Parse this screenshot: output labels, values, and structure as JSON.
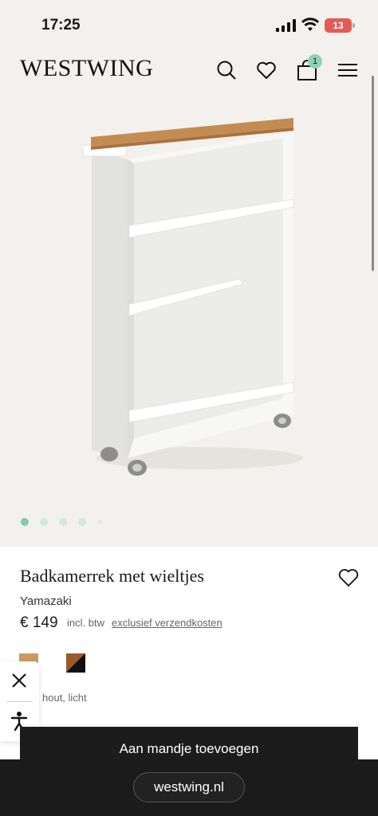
{
  "status": {
    "time": "17:25",
    "battery": "13"
  },
  "header": {
    "logo": "WESTWING",
    "cart_count": "1"
  },
  "gallery": {
    "slides": 5,
    "active_slide": 1
  },
  "product": {
    "title": "Badkamerrek met wieltjes",
    "brand": "Yamazaki",
    "price": "€ 149",
    "vat_note": "incl. btw",
    "shipping_link": "exclusief verzendkosten",
    "variant": "hout, licht"
  },
  "actions": {
    "add_to_cart": "Aan mandje toevoegen"
  },
  "browser": {
    "url": "westwing.nl"
  },
  "colors": {
    "accent": "#86c9b4",
    "button": "#1c1c1c",
    "wood": "#c89b63"
  }
}
